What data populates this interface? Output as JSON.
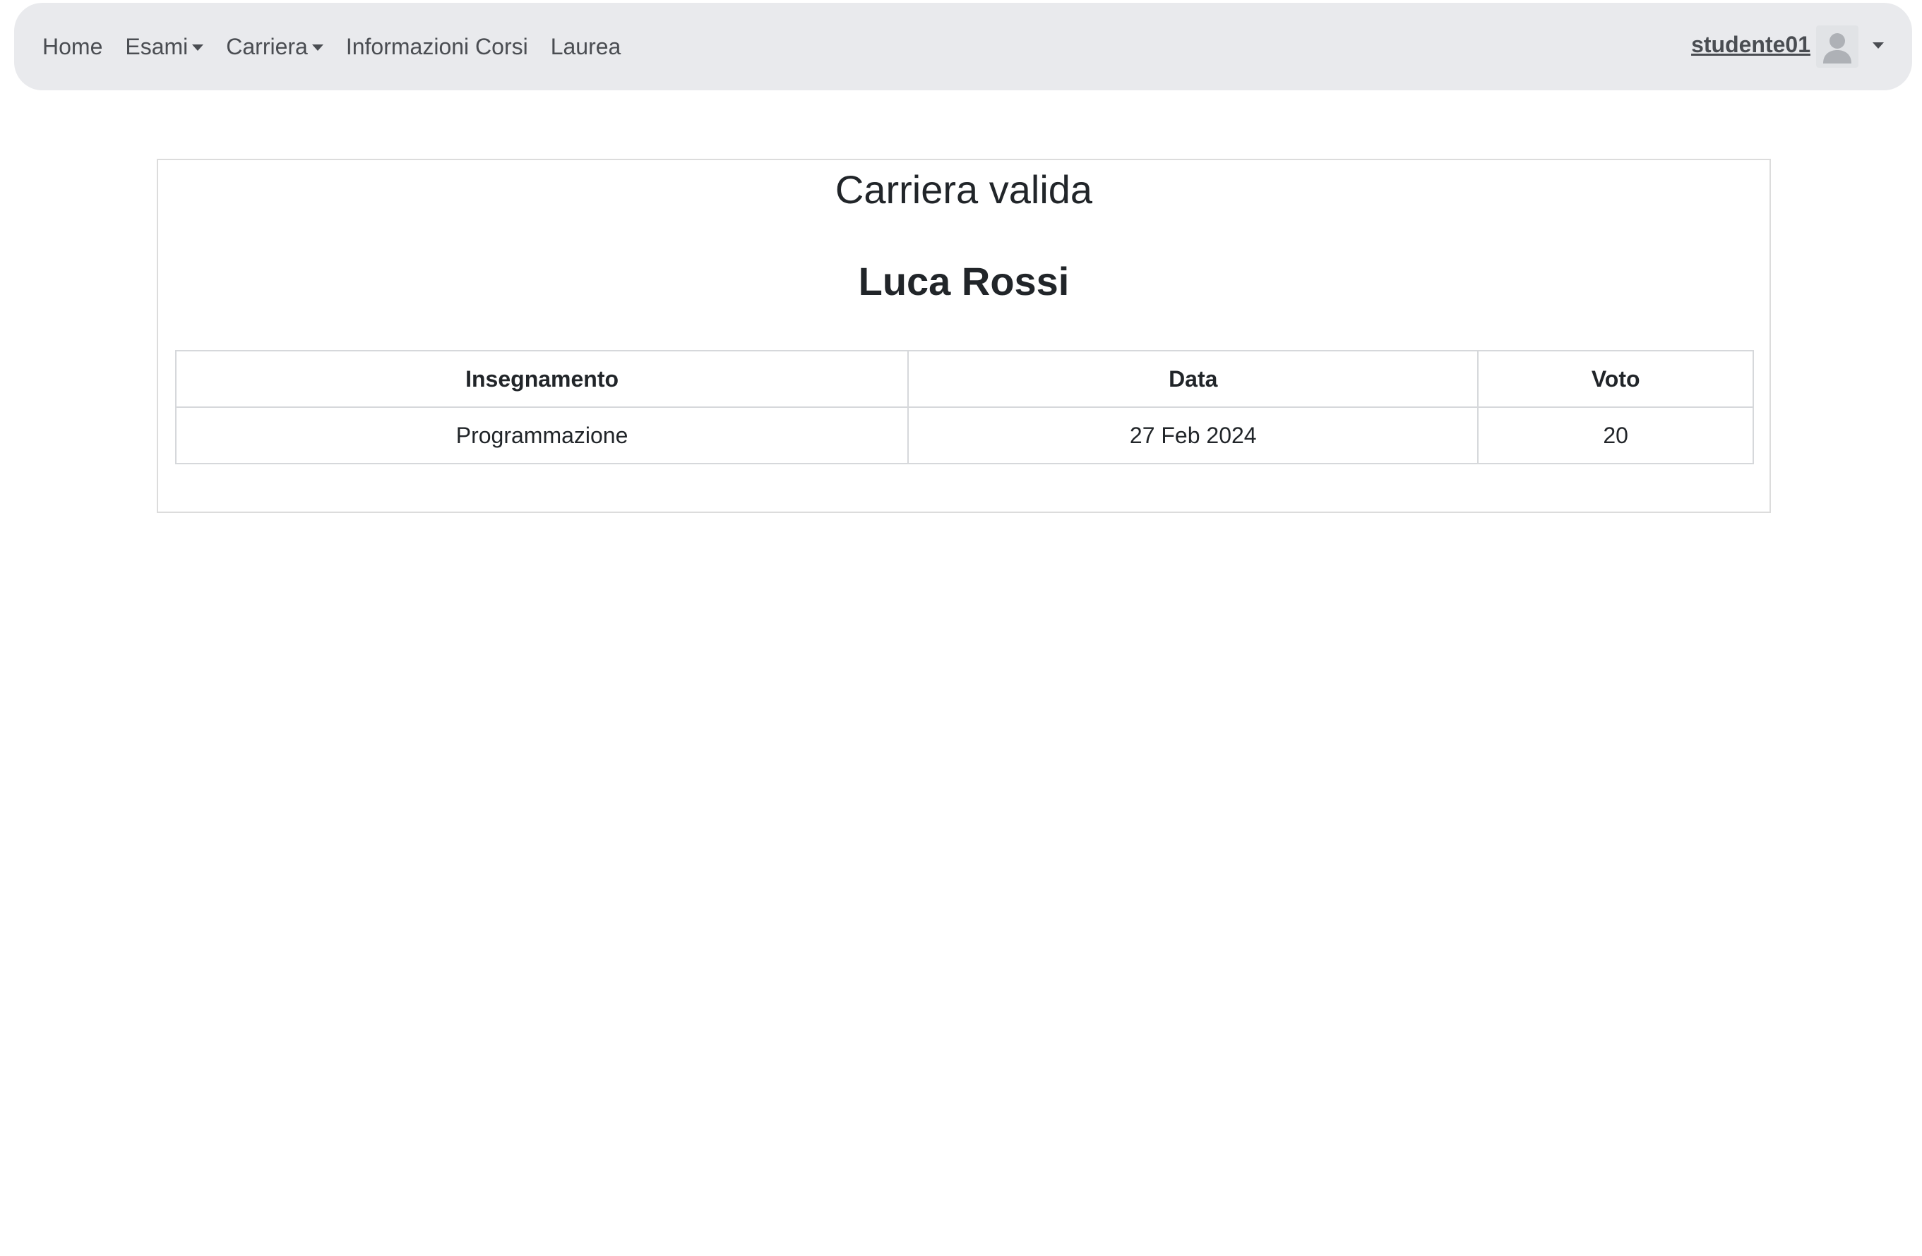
{
  "navbar": {
    "items": [
      {
        "label": "Home",
        "dropdown": false
      },
      {
        "label": "Esami",
        "dropdown": true
      },
      {
        "label": "Carriera",
        "dropdown": true
      },
      {
        "label": "Informazioni Corsi",
        "dropdown": false
      },
      {
        "label": "Laurea",
        "dropdown": false
      }
    ],
    "user": {
      "username": "studente01",
      "avatar_icon": "user-avatar-icon"
    },
    "background_color": "#e9eaed"
  },
  "main": {
    "title": "Carriera valida",
    "student_name": "Luca Rossi",
    "table": {
      "headers": [
        "Insegnamento",
        "Data",
        "Voto"
      ],
      "rows": [
        [
          "Programmazione",
          "27 Feb 2024",
          "20"
        ]
      ]
    }
  }
}
